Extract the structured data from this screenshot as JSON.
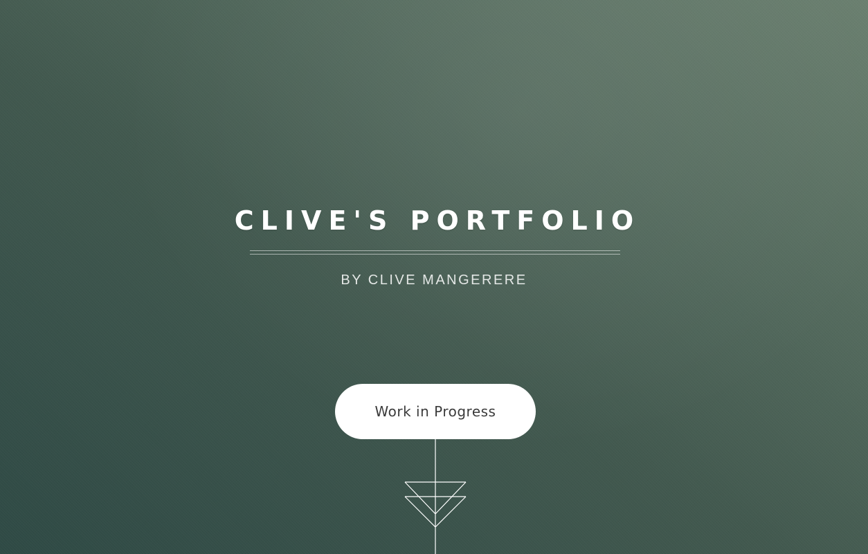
{
  "hero": {
    "title": "CLIVE'S PORTFOLIO",
    "byline": "BY CLIVE MANGERERE",
    "button_label": "Work in Progress"
  },
  "icons": {
    "scroll_down": "double-chevron-down-icon"
  },
  "colors": {
    "background_dark": "#2f4a45",
    "background_light": "#6a7f6f",
    "text": "#ffffff",
    "button_bg": "#ffffff",
    "button_text": "#3b3b3b"
  }
}
